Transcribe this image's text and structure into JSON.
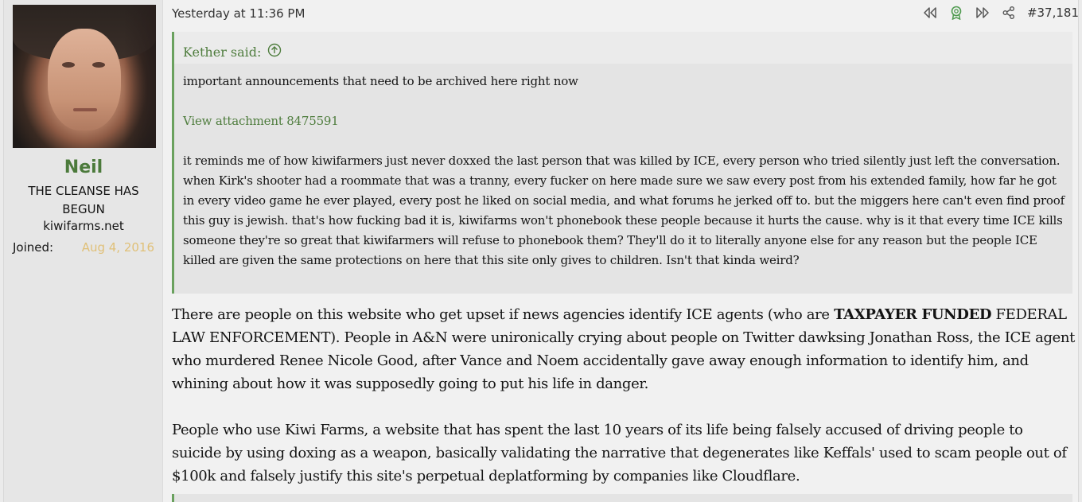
{
  "user": {
    "name": "Neil",
    "title": "THE CLEANSE HAS BEGUN",
    "site": "kiwifarms.net",
    "joined_label": "Joined:",
    "joined_value": "Aug 4, 2016"
  },
  "post": {
    "timestamp": "Yesterday at 11:36 PM",
    "number": "#37,181",
    "icons": [
      "rewind-icon",
      "award-icon",
      "fast-forward-icon",
      "share-icon"
    ]
  },
  "quote": {
    "author": "Kether said:",
    "line1": "important announcements that need to be archived here right now",
    "attachment": "View attachment 8475591",
    "body": "it reminds me of how kiwifarmers just never doxxed the last person that was killed by ICE, every person who tried silently just left the conversation. when Kirk's shooter had a roommate that was a tranny, every fucker on here made sure we saw every post from his extended family, how far he got in every video game he ever played, every post he liked on social media, and what forums he jerked off to. but the miggers here can't even find proof this guy is jewish. that's how fucking bad it is, kiwifarms won't phonebook these people because it hurts the cause. why is it that every time ICE kills someone they're so great that kiwifarmers will refuse to phonebook them? They'll do it to literally anyone else for any reason but the people ICE killed are given the same protections on here that this site only gives to children. Isn't that kinda weird?"
  },
  "message": {
    "p1_before": "There are people on this website who get upset if news agencies identify ICE agents (who are ",
    "p1_bold": "TAXPAYER FUNDED",
    "p1_after": " FEDERAL LAW ENFORCEMENT). People in A&N were unironically crying about people on Twitter dawksing Jonathan Ross, the ICE agent who murdered Renee Nicole Good, after Vance and Noem accidentally gave away enough information to identify him, and whining about how it was supposedly going to put his life in danger.",
    "p2": "People who use Kiwi Farms, a website that has spent the last 10 years of its life being falsely accused of driving people to suicide by using doxing as a weapon, basically validating the narrative that degenerates like Keffals' used to scam people out of $100k and falsely justify this site's perpetual deplatforming by companies like Cloudflare."
  },
  "colors": {
    "accent_green": "#4f7d3e",
    "username_green": "#4b7a3b",
    "joined_gold": "#e0c078"
  }
}
